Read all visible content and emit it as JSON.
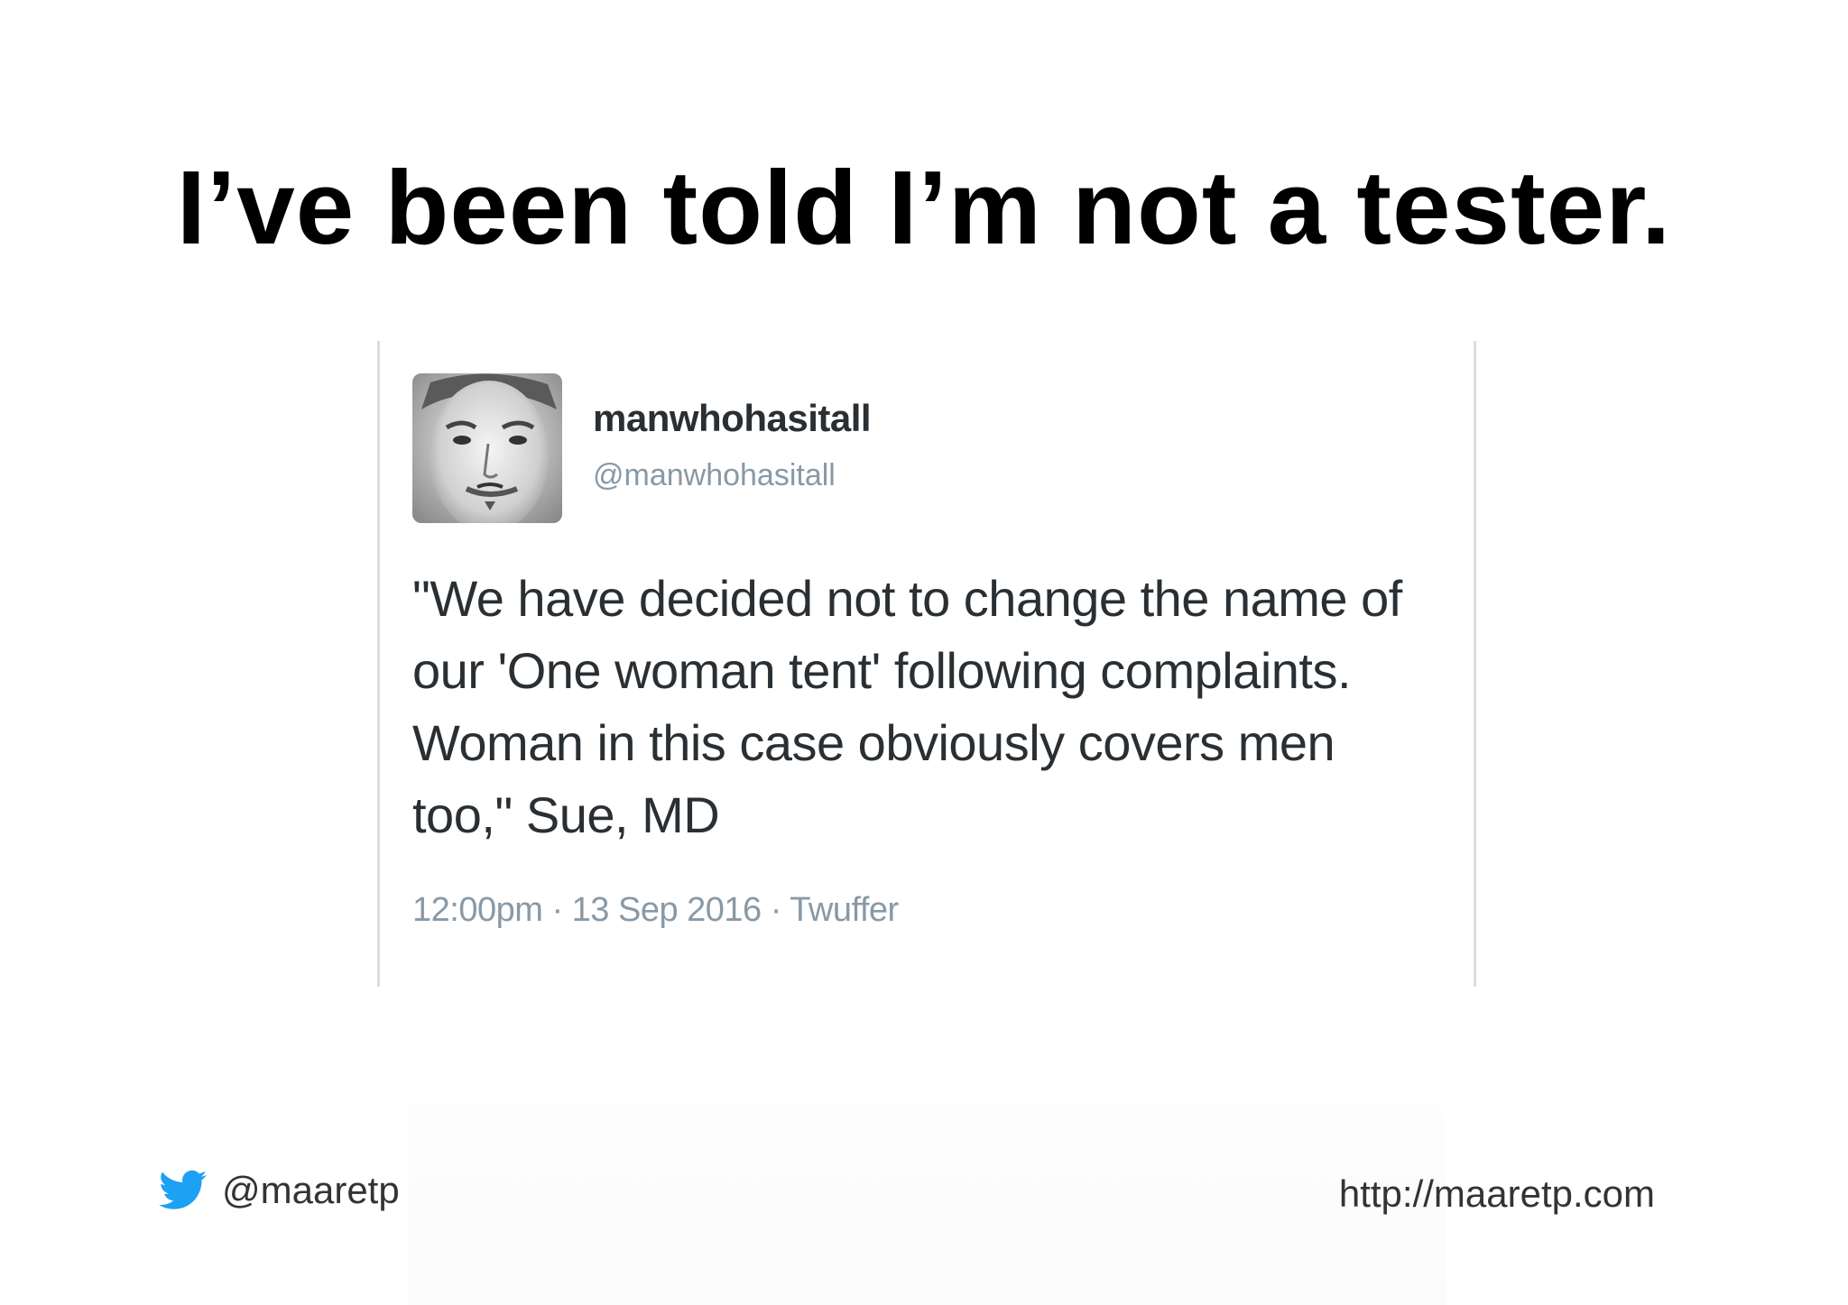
{
  "slide": {
    "title": "I’ve been told I’m not a tester."
  },
  "tweet": {
    "avatar_icon": "user-avatar-photo",
    "display_name": "manwhohasitall",
    "handle": "@manwhohasitall",
    "text": "\"We have decided not to change the name of our 'One woman tent' following complaints. Woman in this case obviously covers men too,\" Sue, MD",
    "meta": "12:00pm · 13 Sep 2016 · Twuffer"
  },
  "footer": {
    "twitter_icon": "twitter-bird-icon",
    "twitter_color": "#1da1f2",
    "handle": "@maaretp",
    "url": "http://maaretp.com"
  }
}
